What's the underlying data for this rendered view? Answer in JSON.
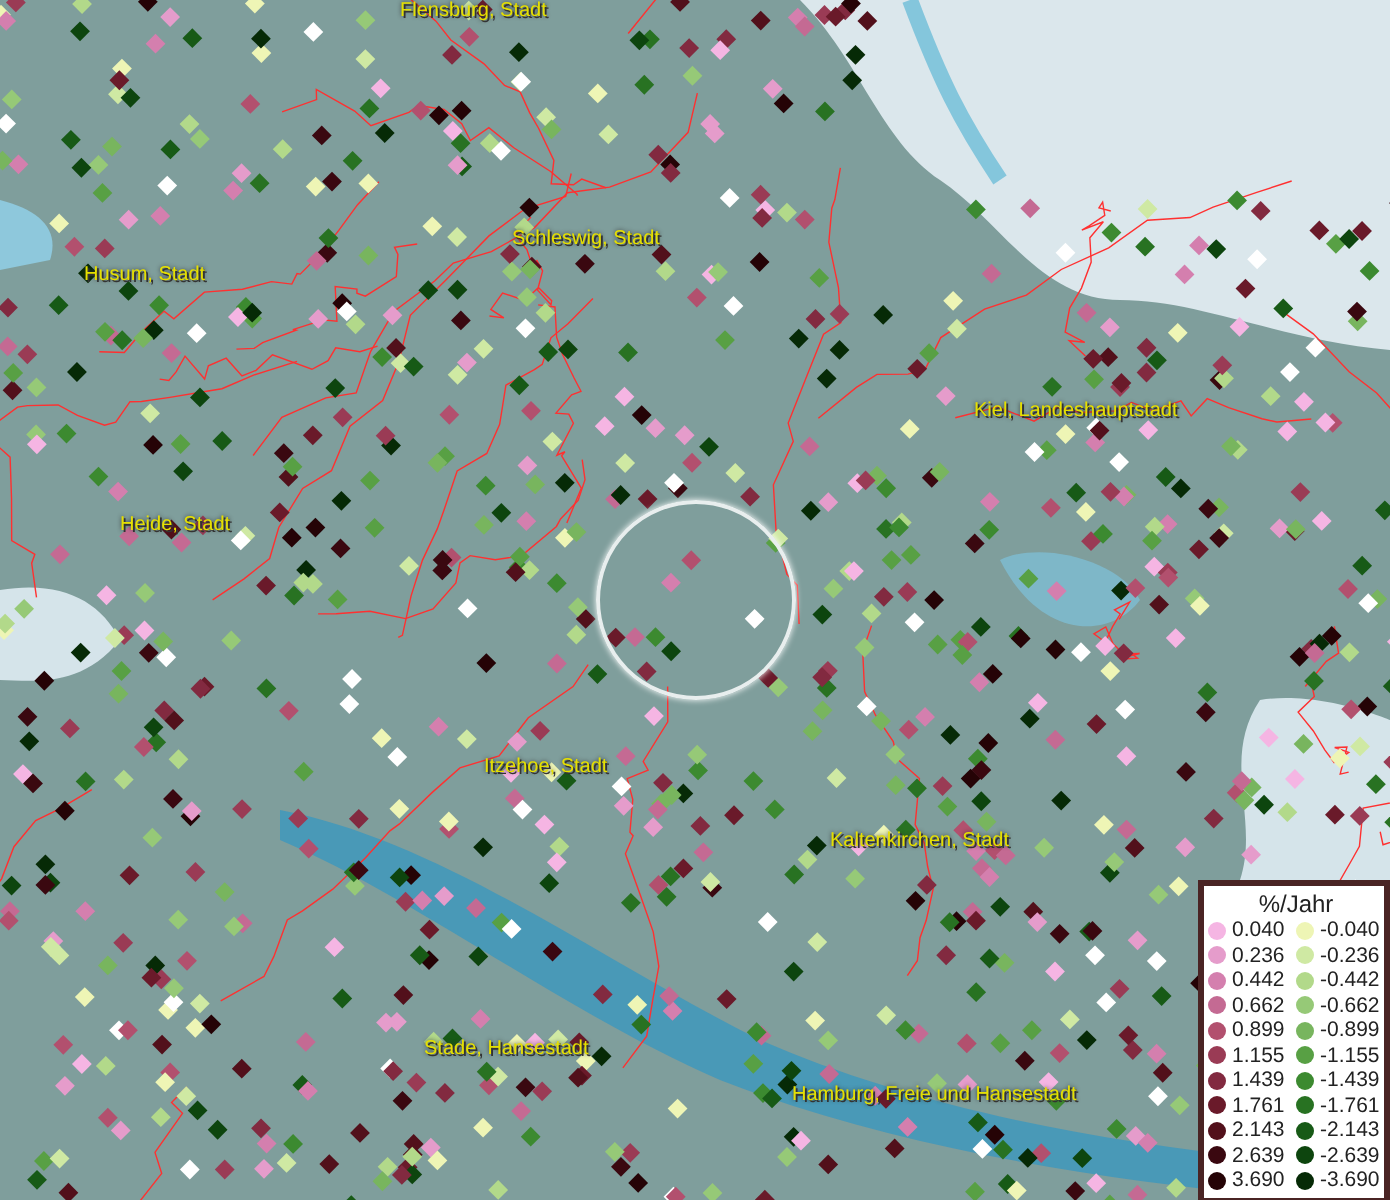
{
  "map": {
    "places": [
      {
        "name": "Flensburg, Stadt"
      },
      {
        "name": "Schleswig, Stadt"
      },
      {
        "name": "Husum, Stadt"
      },
      {
        "name": "Kiel, Landeshauptstadt"
      },
      {
        "name": "Heide, Stadt"
      },
      {
        "name": "Itzehoe, Stadt"
      },
      {
        "name": "Kaltenkirchen, Stadt"
      },
      {
        "name": "Stade, Hansestadt"
      },
      {
        "name": "Hamburg, Freie und Hansestadt"
      }
    ]
  },
  "legend": {
    "title": "%/Jahr",
    "rows": [
      [
        {
          "value": "0.040",
          "color": "#f5b5e3"
        },
        {
          "value": "-0.040",
          "color": "#eef5b5"
        }
      ],
      [
        {
          "value": "0.236",
          "color": "#e59ccb"
        },
        {
          "value": "-0.236",
          "color": "#cfe9a3"
        }
      ],
      [
        {
          "value": "0.442",
          "color": "#d47fae"
        },
        {
          "value": "-0.442",
          "color": "#b2d98a"
        }
      ],
      [
        {
          "value": "0.662",
          "color": "#c46a93"
        },
        {
          "value": "-0.662",
          "color": "#96c977"
        }
      ],
      [
        {
          "value": "0.899",
          "color": "#b2506e"
        },
        {
          "value": "-0.899",
          "color": "#78b55e"
        }
      ],
      [
        {
          "value": "1.155",
          "color": "#9a3b55"
        },
        {
          "value": "-1.155",
          "color": "#58a044"
        }
      ],
      [
        {
          "value": "1.439",
          "color": "#822a40"
        },
        {
          "value": "-1.439",
          "color": "#3c8a30"
        }
      ],
      [
        {
          "value": "1.761",
          "color": "#6a1a2a"
        },
        {
          "value": "-1.761",
          "color": "#287222"
        }
      ],
      [
        {
          "value": "2.143",
          "color": "#52101b"
        },
        {
          "value": "-2.143",
          "color": "#175a16"
        }
      ],
      [
        {
          "value": "2.639",
          "color": "#3a0810"
        },
        {
          "value": "-2.639",
          "color": "#0d450e"
        }
      ],
      [
        {
          "value": "3.690",
          "color": "#250306"
        },
        {
          "value": "-3.690",
          "color": "#062a06"
        }
      ]
    ]
  }
}
